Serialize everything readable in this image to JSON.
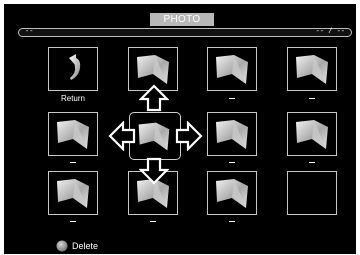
{
  "header": {
    "title": "PHOTO"
  },
  "progress": {
    "left_text": "--",
    "right_text": "-- / --"
  },
  "grid": {
    "cells": [
      {
        "name": "return",
        "label": "Return",
        "icon": "return-arrow-icon"
      },
      {
        "name": "photo",
        "label": "",
        "icon": "photo-icon"
      },
      {
        "name": "photo",
        "label": "",
        "icon": "photo-icon"
      },
      {
        "name": "photo",
        "label": "",
        "icon": "photo-icon"
      },
      {
        "name": "photo",
        "label": "",
        "icon": "photo-icon"
      },
      {
        "name": "photo",
        "label": "",
        "icon": "photo-icon",
        "selected": true
      },
      {
        "name": "photo",
        "label": "",
        "icon": "photo-icon"
      },
      {
        "name": "photo",
        "label": "",
        "icon": "photo-icon"
      },
      {
        "name": "photo",
        "label": "",
        "icon": "photo-icon"
      },
      {
        "name": "photo",
        "label": "",
        "icon": "photo-icon"
      },
      {
        "name": "photo",
        "label": "",
        "icon": "photo-icon"
      },
      {
        "name": "empty",
        "label": "",
        "icon": ""
      }
    ]
  },
  "navigation": {
    "arrows": [
      "up-arrow-icon",
      "down-arrow-icon",
      "left-arrow-icon",
      "right-arrow-icon"
    ]
  },
  "footer": {
    "delete_label": "Delete",
    "delete_color": "#7a7a7a"
  },
  "colors": {
    "background": "#000000",
    "title_tab": "#b8b8b8",
    "border": "#c7c7c7"
  }
}
